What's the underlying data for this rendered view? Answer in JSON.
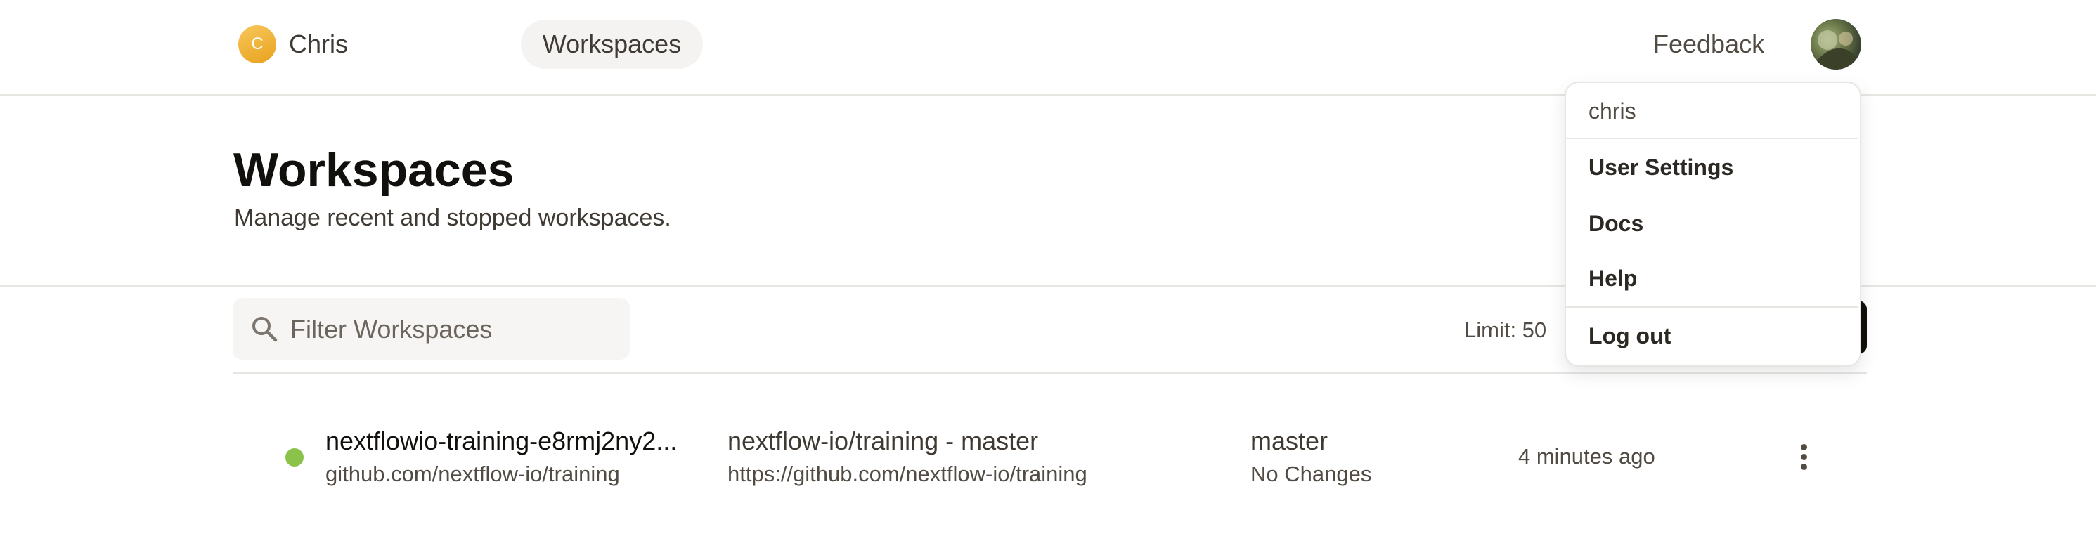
{
  "header": {
    "org_initial": "C",
    "org_name": "Chris",
    "nav_workspaces": "Workspaces",
    "feedback": "Feedback"
  },
  "page": {
    "title": "Workspaces",
    "subtitle": "Manage recent and stopped workspaces."
  },
  "toolbar": {
    "filter_placeholder": "Filter Workspaces",
    "limit_label": "Limit: 50"
  },
  "workspaces": [
    {
      "name": "nextflowio-training-e8rmj2ny2...",
      "repo": "github.com/nextflow-io/training",
      "context_title": "nextflow-io/training - master",
      "context_url": "https://github.com/nextflow-io/training",
      "branch": "master",
      "changes": "No Changes",
      "last_active": "4 minutes ago",
      "status_color": "#8bc34a"
    }
  ],
  "user_menu": {
    "username": "chris",
    "items": [
      "User Settings",
      "Docs",
      "Help",
      "Log out"
    ]
  }
}
